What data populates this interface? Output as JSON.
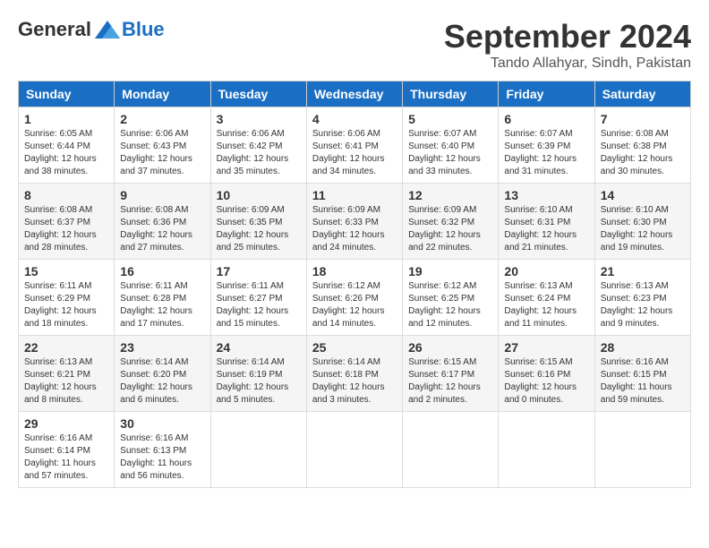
{
  "header": {
    "logo_general": "General",
    "logo_blue": "Blue",
    "month_title": "September 2024",
    "subtitle": "Tando Allahyar, Sindh, Pakistan"
  },
  "weekdays": [
    "Sunday",
    "Monday",
    "Tuesday",
    "Wednesday",
    "Thursday",
    "Friday",
    "Saturday"
  ],
  "weeks": [
    [
      {
        "day": "1",
        "info": "Sunrise: 6:05 AM\nSunset: 6:44 PM\nDaylight: 12 hours\nand 38 minutes."
      },
      {
        "day": "2",
        "info": "Sunrise: 6:06 AM\nSunset: 6:43 PM\nDaylight: 12 hours\nand 37 minutes."
      },
      {
        "day": "3",
        "info": "Sunrise: 6:06 AM\nSunset: 6:42 PM\nDaylight: 12 hours\nand 35 minutes."
      },
      {
        "day": "4",
        "info": "Sunrise: 6:06 AM\nSunset: 6:41 PM\nDaylight: 12 hours\nand 34 minutes."
      },
      {
        "day": "5",
        "info": "Sunrise: 6:07 AM\nSunset: 6:40 PM\nDaylight: 12 hours\nand 33 minutes."
      },
      {
        "day": "6",
        "info": "Sunrise: 6:07 AM\nSunset: 6:39 PM\nDaylight: 12 hours\nand 31 minutes."
      },
      {
        "day": "7",
        "info": "Sunrise: 6:08 AM\nSunset: 6:38 PM\nDaylight: 12 hours\nand 30 minutes."
      }
    ],
    [
      {
        "day": "8",
        "info": "Sunrise: 6:08 AM\nSunset: 6:37 PM\nDaylight: 12 hours\nand 28 minutes."
      },
      {
        "day": "9",
        "info": "Sunrise: 6:08 AM\nSunset: 6:36 PM\nDaylight: 12 hours\nand 27 minutes."
      },
      {
        "day": "10",
        "info": "Sunrise: 6:09 AM\nSunset: 6:35 PM\nDaylight: 12 hours\nand 25 minutes."
      },
      {
        "day": "11",
        "info": "Sunrise: 6:09 AM\nSunset: 6:33 PM\nDaylight: 12 hours\nand 24 minutes."
      },
      {
        "day": "12",
        "info": "Sunrise: 6:09 AM\nSunset: 6:32 PM\nDaylight: 12 hours\nand 22 minutes."
      },
      {
        "day": "13",
        "info": "Sunrise: 6:10 AM\nSunset: 6:31 PM\nDaylight: 12 hours\nand 21 minutes."
      },
      {
        "day": "14",
        "info": "Sunrise: 6:10 AM\nSunset: 6:30 PM\nDaylight: 12 hours\nand 19 minutes."
      }
    ],
    [
      {
        "day": "15",
        "info": "Sunrise: 6:11 AM\nSunset: 6:29 PM\nDaylight: 12 hours\nand 18 minutes."
      },
      {
        "day": "16",
        "info": "Sunrise: 6:11 AM\nSunset: 6:28 PM\nDaylight: 12 hours\nand 17 minutes."
      },
      {
        "day": "17",
        "info": "Sunrise: 6:11 AM\nSunset: 6:27 PM\nDaylight: 12 hours\nand 15 minutes."
      },
      {
        "day": "18",
        "info": "Sunrise: 6:12 AM\nSunset: 6:26 PM\nDaylight: 12 hours\nand 14 minutes."
      },
      {
        "day": "19",
        "info": "Sunrise: 6:12 AM\nSunset: 6:25 PM\nDaylight: 12 hours\nand 12 minutes."
      },
      {
        "day": "20",
        "info": "Sunrise: 6:13 AM\nSunset: 6:24 PM\nDaylight: 12 hours\nand 11 minutes."
      },
      {
        "day": "21",
        "info": "Sunrise: 6:13 AM\nSunset: 6:23 PM\nDaylight: 12 hours\nand 9 minutes."
      }
    ],
    [
      {
        "day": "22",
        "info": "Sunrise: 6:13 AM\nSunset: 6:21 PM\nDaylight: 12 hours\nand 8 minutes."
      },
      {
        "day": "23",
        "info": "Sunrise: 6:14 AM\nSunset: 6:20 PM\nDaylight: 12 hours\nand 6 minutes."
      },
      {
        "day": "24",
        "info": "Sunrise: 6:14 AM\nSunset: 6:19 PM\nDaylight: 12 hours\nand 5 minutes."
      },
      {
        "day": "25",
        "info": "Sunrise: 6:14 AM\nSunset: 6:18 PM\nDaylight: 12 hours\nand 3 minutes."
      },
      {
        "day": "26",
        "info": "Sunrise: 6:15 AM\nSunset: 6:17 PM\nDaylight: 12 hours\nand 2 minutes."
      },
      {
        "day": "27",
        "info": "Sunrise: 6:15 AM\nSunset: 6:16 PM\nDaylight: 12 hours\nand 0 minutes."
      },
      {
        "day": "28",
        "info": "Sunrise: 6:16 AM\nSunset: 6:15 PM\nDaylight: 11 hours\nand 59 minutes."
      }
    ],
    [
      {
        "day": "29",
        "info": "Sunrise: 6:16 AM\nSunset: 6:14 PM\nDaylight: 11 hours\nand 57 minutes."
      },
      {
        "day": "30",
        "info": "Sunrise: 6:16 AM\nSunset: 6:13 PM\nDaylight: 11 hours\nand 56 minutes."
      },
      {
        "day": "",
        "info": ""
      },
      {
        "day": "",
        "info": ""
      },
      {
        "day": "",
        "info": ""
      },
      {
        "day": "",
        "info": ""
      },
      {
        "day": "",
        "info": ""
      }
    ]
  ]
}
